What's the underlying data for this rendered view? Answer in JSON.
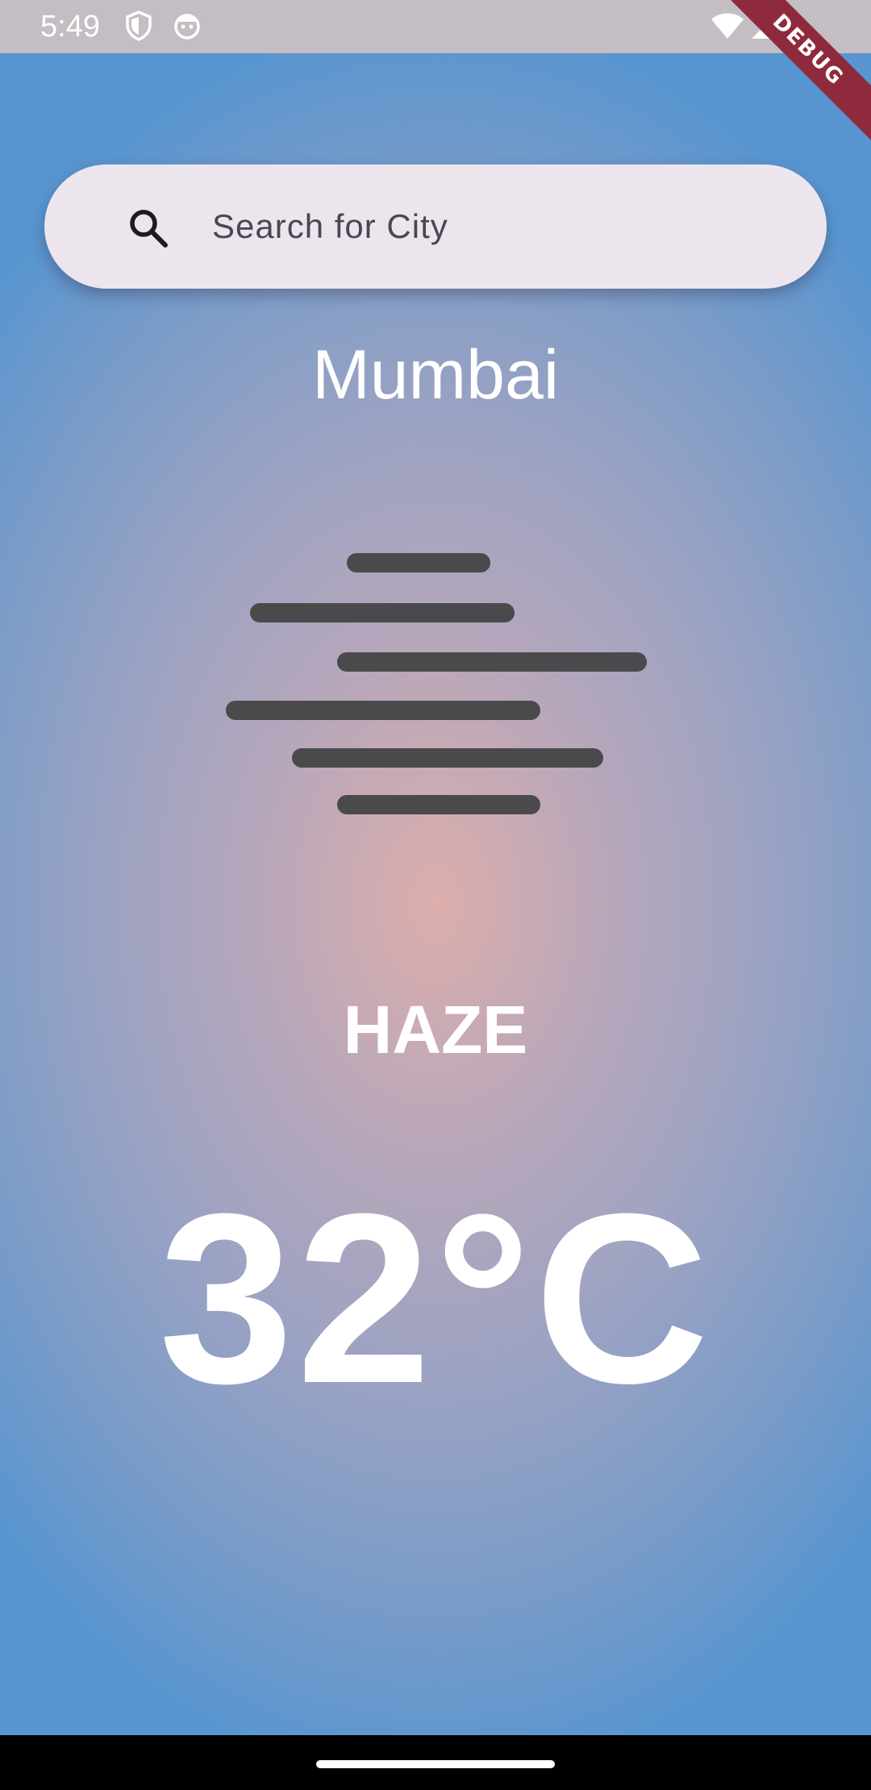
{
  "status_bar": {
    "time": "5:49",
    "left_icons": [
      "shield-icon",
      "android-face-icon"
    ],
    "right_icons": [
      "wifi-icon",
      "signal-icon"
    ]
  },
  "debug_banner": {
    "label": "DEBUG",
    "color": "#8e2a3c"
  },
  "search": {
    "placeholder": "Search for City",
    "value": "",
    "icon": "search-icon"
  },
  "weather": {
    "city": "Mumbai",
    "icon": "haze-icon",
    "condition": "HAZE",
    "temperature": "32°C"
  },
  "colors": {
    "background_edge": "#5895d0",
    "background_center": "#dcaeac",
    "text": "#ffffff",
    "search_bg": "#ede5ee"
  }
}
